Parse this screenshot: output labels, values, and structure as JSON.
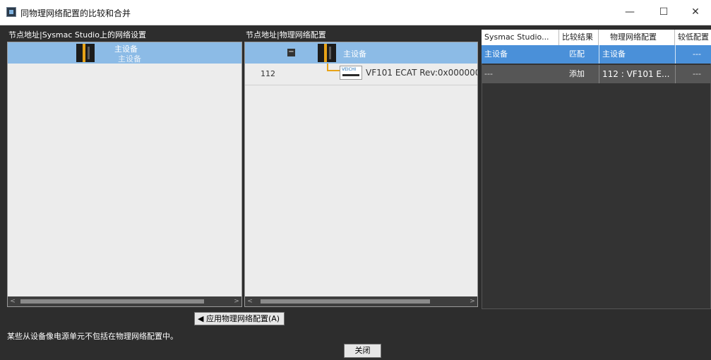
{
  "window": {
    "title": "同物理网络配置的比较和合并",
    "minimize": "—",
    "maximize": "☐",
    "close": "✕"
  },
  "left_panel": {
    "header": "节点地址|Sysmac Studio上的网络设置",
    "device_name": "主设备",
    "device_model": "主设备"
  },
  "mid_panel": {
    "header": "节点地址|物理网络配置",
    "master_label": "主设备",
    "collapse_symbol": "−",
    "slave_address": "112",
    "slave_device": "VF101 ECAT Rev:0x000000",
    "slave_icon_text": "VEICHI"
  },
  "compare_grid": {
    "columns": [
      "Sysmac Studio...",
      "比较结果",
      "物理网络配置",
      "较低配置"
    ],
    "rows": [
      {
        "sysmac": "主设备",
        "result": "匹配",
        "physical": "主设备",
        "lower": "---"
      },
      {
        "sysmac": "---",
        "result": "添加",
        "physical": "112 : VF101 E...",
        "lower": "---"
      }
    ]
  },
  "buttons": {
    "apply": "◀ 应用物理网络配置(A)",
    "close": "关闭"
  },
  "status_message": "某些从设备像电源单元不包括在物理网络配置中。",
  "colors": {
    "selection": "#8cbbe6",
    "panel_bg": "#ececec",
    "dark_bg": "#2d2d2d",
    "grid_row_selected": "#4a90d9"
  }
}
